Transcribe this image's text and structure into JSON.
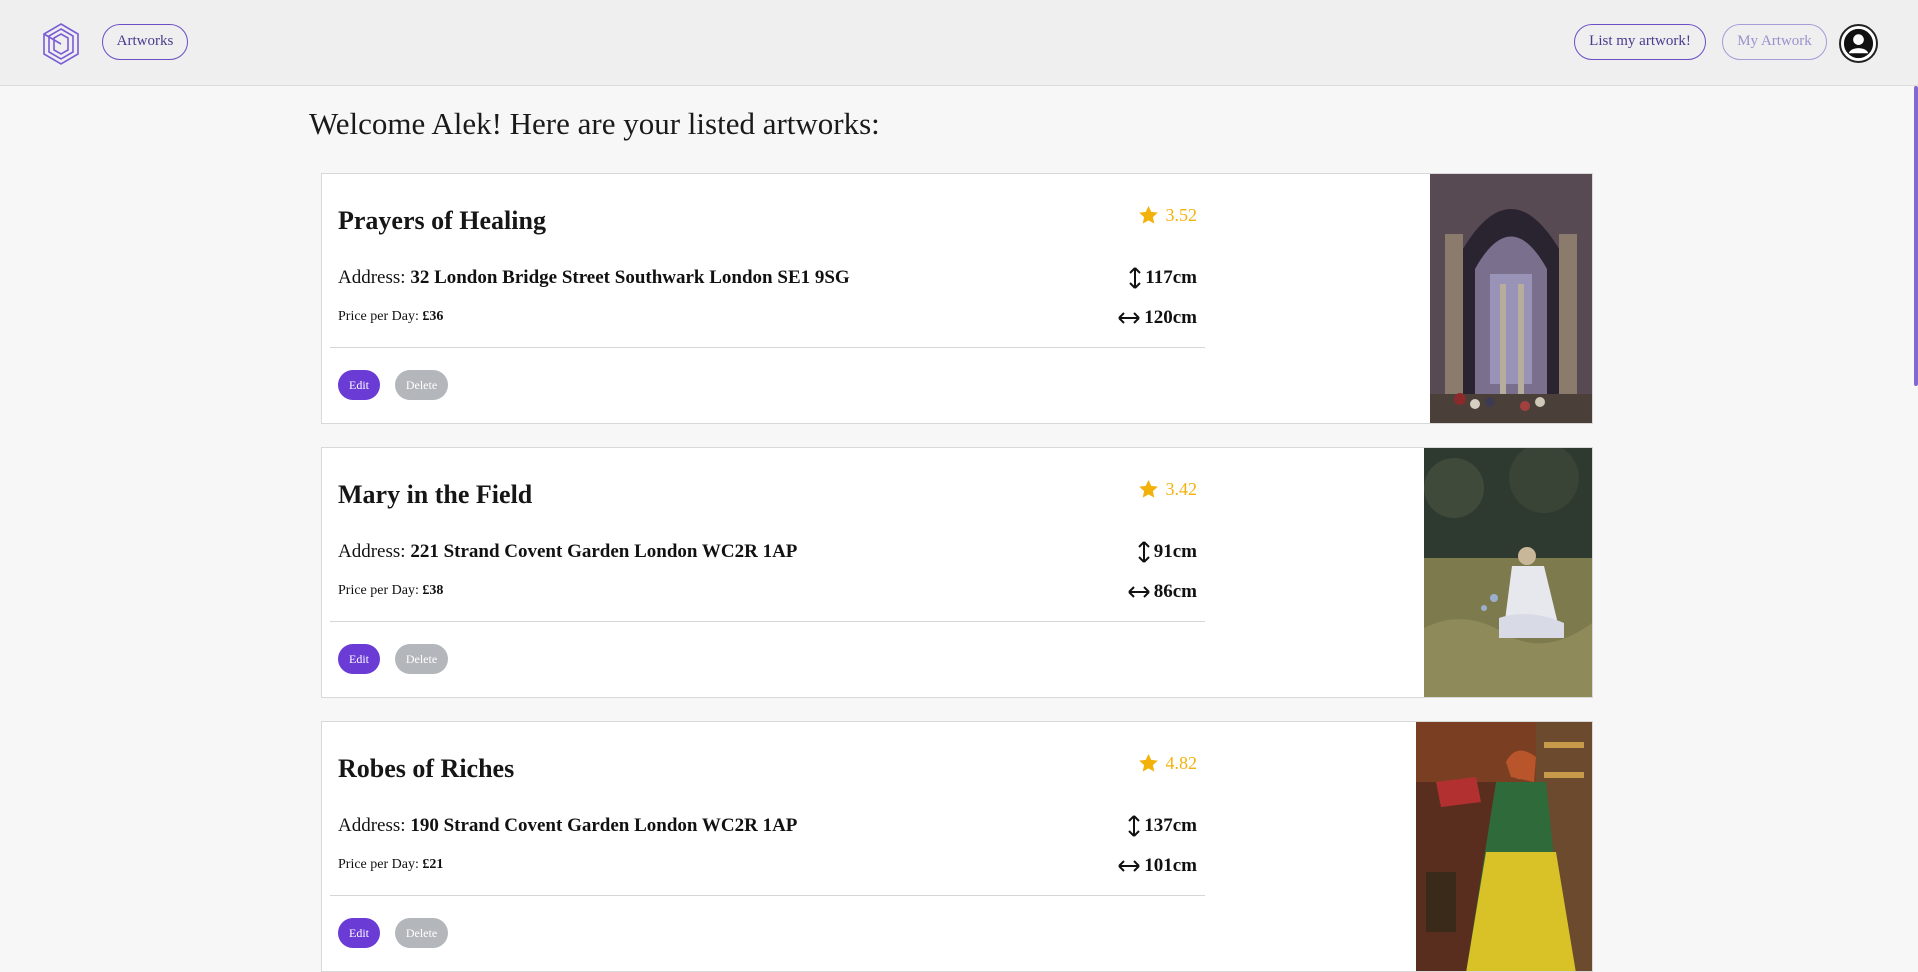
{
  "nav": {
    "artworks_label": "Artworks",
    "list_label": "List my artwork!",
    "my_artwork_label": "My Artwork"
  },
  "colors": {
    "accent": "#6b3bd6",
    "rating": "#f3b10c",
    "delete": "#b3b6bb"
  },
  "welcome": "Welcome Alek! Here are your listed artworks:",
  "labels": {
    "address": "Address:",
    "price": "Price per Day:",
    "edit": "Edit",
    "delete": "Delete"
  },
  "artworks": [
    {
      "title": "Prayers of Healing",
      "rating": "3.52",
      "address": "32 London Bridge Street Southwark London SE1 9SG",
      "price": "£36",
      "height": "117cm",
      "width": "120cm",
      "image": "gothic-cathedral-interior-painting"
    },
    {
      "title": "Mary in the Field",
      "rating": "3.42",
      "address": "221 Strand Covent Garden London WC2R 1AP",
      "price": "£38",
      "height": "91cm",
      "width": "86cm",
      "image": "girl-in-white-dress-meadow-painting"
    },
    {
      "title": "Robes of Riches",
      "rating": "4.82",
      "address": "190 Strand Covent Garden London WC2R 1AP",
      "price": "£21",
      "height": "137cm",
      "width": "101cm",
      "image": "woman-in-green-robe-painting"
    }
  ]
}
